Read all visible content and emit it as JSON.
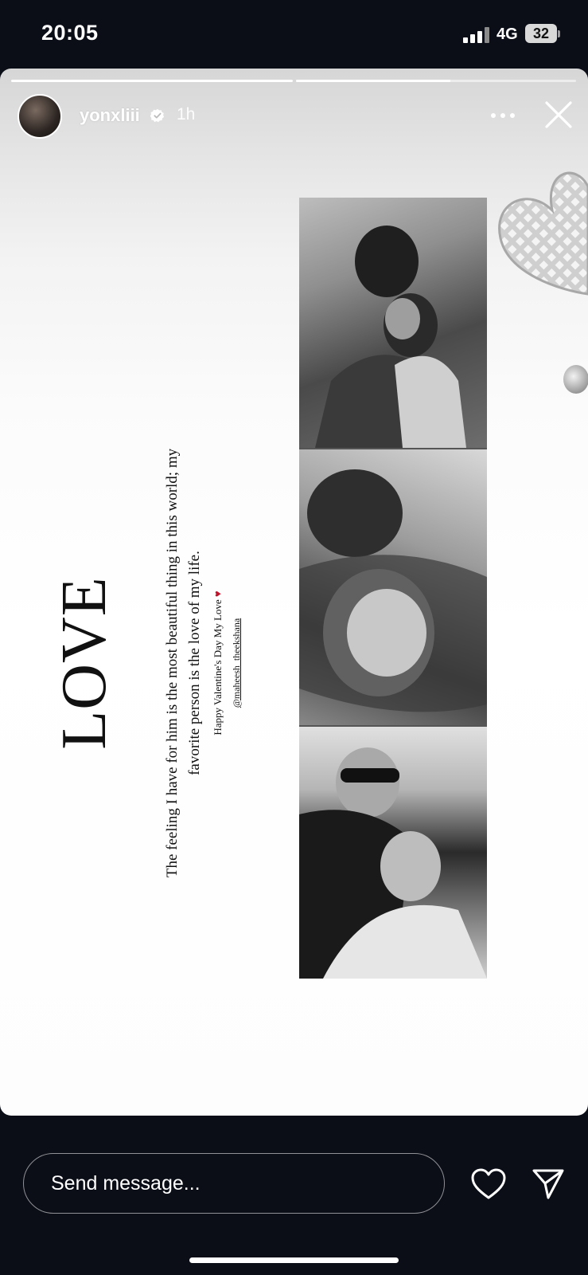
{
  "status_bar": {
    "time": "20:05",
    "network": "4G",
    "battery": "32"
  },
  "story": {
    "username": "yonxliii",
    "age": "1h",
    "segments": [
      {
        "progress": 1.0
      },
      {
        "progress": 0.55
      }
    ],
    "love_word": "LOVE",
    "caption": "The feeling I have for him is the most beautiful thing in this world; my favorite person is the love of my life.",
    "valentine_text": "Happy Valentine's Day My Love",
    "mention": "@maheesh_theekshana"
  },
  "bottom": {
    "message_placeholder": "Send message..."
  },
  "colors": {
    "background": "#0b0d17",
    "kiss": "#c0142c"
  },
  "icons": [
    "verified-icon",
    "more-icon",
    "close-icon",
    "heart-icon",
    "send-icon"
  ]
}
